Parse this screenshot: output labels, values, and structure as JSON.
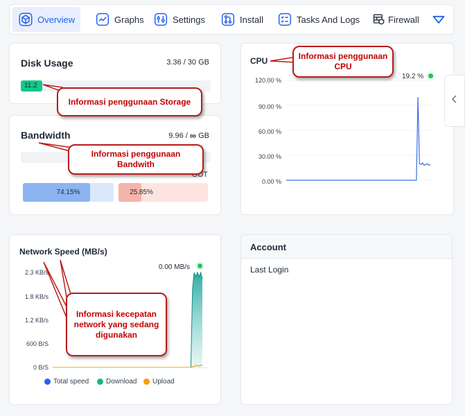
{
  "nav": {
    "tabs": [
      {
        "label": "Overview",
        "icon": "cube-icon",
        "active": true
      },
      {
        "label": "Graphs",
        "icon": "chart-line-icon"
      },
      {
        "label": "Settings",
        "icon": "sliders-icon"
      },
      {
        "label": "Install",
        "icon": "git-branch-icon"
      },
      {
        "label": "Tasks And Logs",
        "icon": "list-check-icon"
      },
      {
        "label": "Firewall",
        "icon": "firewall-icon"
      }
    ],
    "more_icon": "chevron-down-icon"
  },
  "disk": {
    "title": "Disk Usage",
    "value": "3.36 / 30 GB",
    "percent_label": "11.2",
    "percent": 11.2,
    "callout": "Informasi penggunaan Storage"
  },
  "bandwidth": {
    "title": "Bandwidth",
    "value_prefix": "9.96 /",
    "value_symbol": "∞",
    "value_unit": "GB",
    "callout": "Informasi penggunaan Bandwith",
    "out_label": "OUT",
    "in_percent": "74.15%",
    "in_fraction": 74.15,
    "out_percent": "25.85%",
    "out_fraction": 25.85
  },
  "cpu": {
    "title": "CPU",
    "current": "19.2 %",
    "callout": "Informasi penggunaan CPU",
    "y_ticks": [
      "120.00 %",
      "90.00 %",
      "60.00 %",
      "30.00 %",
      "0.00 %"
    ],
    "status_color": "#22c55e"
  },
  "network": {
    "title": "Network Speed (MB/s)",
    "current": "0.00 MB/s",
    "callout": "Informasi kecepatan network yang sedang digunakan",
    "y_ticks": [
      "2.3 KB/s",
      "1.8 KB/s",
      "1.2 KB/s",
      "600 B/S",
      "0 B/S"
    ],
    "legend": [
      {
        "label": "Total speed",
        "color": "#2563eb"
      },
      {
        "label": "Download",
        "color": "#10b981"
      },
      {
        "label": "Upload",
        "color": "#f59e0b"
      }
    ]
  },
  "account": {
    "title": "Account",
    "last_login_label": "Last Login"
  },
  "chart_data": [
    {
      "type": "line",
      "title": "CPU",
      "ylim": [
        0,
        120
      ],
      "y_ticks": [
        0,
        30,
        60,
        90,
        120
      ],
      "series": [
        {
          "values": [
            0,
            0,
            0,
            0,
            0,
            0,
            0,
            0,
            0,
            0,
            0,
            0,
            0,
            0,
            0,
            0,
            0,
            0,
            0,
            0,
            0,
            0,
            0,
            0,
            0,
            0,
            0,
            0,
            0,
            0,
            0,
            0,
            0,
            0,
            0,
            0,
            0,
            0,
            0,
            0,
            0,
            0,
            0,
            0,
            0,
            0,
            0,
            0,
            0,
            0,
            0,
            0,
            0,
            0,
            0,
            0,
            0,
            0,
            0,
            0,
            0,
            0,
            0,
            0,
            0,
            0,
            0,
            0,
            0,
            0,
            0,
            0,
            0,
            0,
            0,
            0,
            0,
            0,
            0,
            0,
            0,
            0,
            0,
            0,
            0,
            100,
            20,
            19,
            21,
            18,
            19,
            20,
            18,
            19.2
          ]
        }
      ]
    },
    {
      "type": "area",
      "title": "Network Speed (MB/s)",
      "y_ticks": [
        "0 B/S",
        "600 B/S",
        "1.2 KB/s",
        "1.8 KB/s",
        "2.3 KB/s"
      ],
      "ylim": [
        0,
        2.3
      ],
      "series": [
        {
          "name": "Download",
          "values": [
            0,
            0,
            0,
            0,
            0,
            0,
            0,
            0,
            0,
            0,
            0,
            0,
            0,
            0,
            0,
            0,
            0,
            0,
            0,
            0,
            0,
            0,
            0,
            0,
            0,
            0,
            0,
            0,
            0,
            0,
            0,
            0,
            0,
            0,
            0,
            0,
            0,
            0,
            0,
            0,
            0,
            0,
            0,
            0,
            0,
            0,
            0,
            0,
            0,
            0,
            0,
            0,
            0,
            0,
            0,
            0,
            0,
            0,
            0,
            0,
            0,
            0,
            0,
            0,
            0,
            0,
            0,
            0,
            0,
            0,
            0,
            0,
            0,
            0,
            0,
            0,
            0,
            0,
            0,
            0,
            0,
            0,
            0,
            0,
            0,
            1.9,
            2.3,
            2.2,
            2.3,
            2.2,
            2.3,
            2.15
          ]
        },
        {
          "name": "Upload",
          "values": [
            0,
            0,
            0,
            0,
            0,
            0,
            0,
            0,
            0,
            0,
            0,
            0,
            0,
            0,
            0,
            0,
            0,
            0,
            0,
            0,
            0,
            0,
            0,
            0,
            0,
            0,
            0,
            0,
            0,
            0,
            0,
            0,
            0,
            0,
            0,
            0,
            0,
            0,
            0,
            0,
            0,
            0,
            0,
            0,
            0,
            0,
            0,
            0,
            0,
            0,
            0,
            0,
            0,
            0,
            0,
            0,
            0,
            0,
            0,
            0,
            0,
            0,
            0,
            0,
            0,
            0,
            0,
            0,
            0,
            0,
            0,
            0,
            0,
            0,
            0,
            0,
            0,
            0,
            0,
            0,
            0,
            0,
            0,
            0,
            0,
            0.02,
            0.03,
            0.04,
            0.05,
            0.03,
            0.06,
            0.05
          ]
        }
      ]
    }
  ]
}
